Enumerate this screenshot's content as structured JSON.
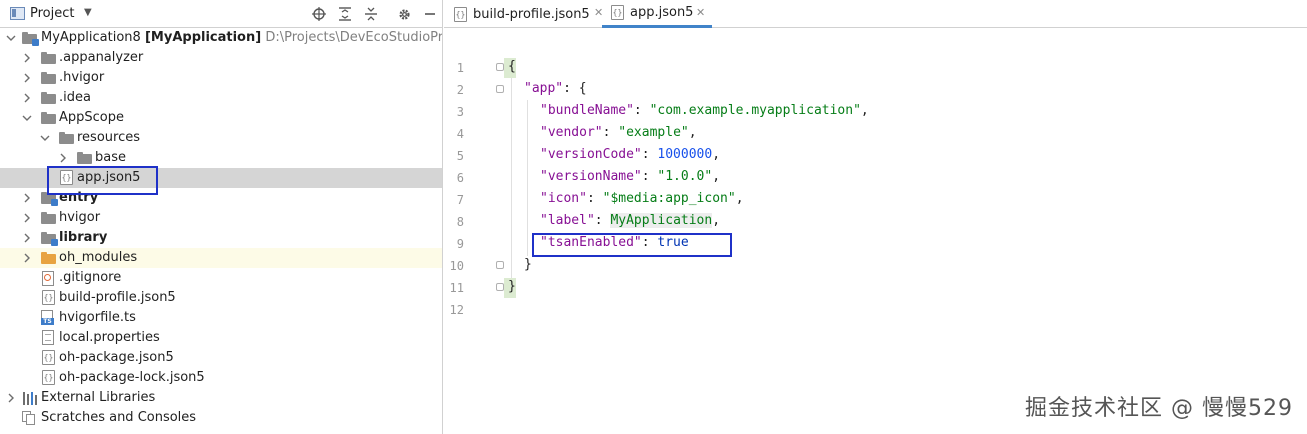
{
  "project_panel": {
    "title": "Project",
    "tree": [
      {
        "label": "MyApplication8",
        "bold_part": "[MyApplication]",
        "path": "D:\\Projects\\DevEcoStudioProjects\\"
      },
      {
        "label": ".appanalyzer"
      },
      {
        "label": ".hvigor"
      },
      {
        "label": ".idea"
      },
      {
        "label": "AppScope"
      },
      {
        "label": "resources"
      },
      {
        "label": "base"
      },
      {
        "label": "app.json5"
      },
      {
        "label": "entry"
      },
      {
        "label": "hvigor"
      },
      {
        "label": "library"
      },
      {
        "label": "oh_modules"
      },
      {
        "label": ".gitignore"
      },
      {
        "label": "build-profile.json5"
      },
      {
        "label": "hvigorfile.ts"
      },
      {
        "label": "local.properties"
      },
      {
        "label": "oh-package.json5"
      },
      {
        "label": "oh-package-lock.json5"
      },
      {
        "label": "External Libraries"
      },
      {
        "label": "Scratches and Consoles"
      }
    ]
  },
  "editor": {
    "tabs": [
      {
        "label": "build-profile.json5",
        "active": false
      },
      {
        "label": "app.json5",
        "active": true
      }
    ],
    "line_numbers": [
      "1",
      "2",
      "3",
      "4",
      "5",
      "6",
      "7",
      "8",
      "9",
      "10",
      "11",
      "12"
    ],
    "code": {
      "l1": "{",
      "l2_key": "\"app\"",
      "l2_rest": ": {",
      "l3_key": "\"bundleName\"",
      "l3_val": "\"com.example.myapplication\"",
      "l4_key": "\"vendor\"",
      "l4_val": "\"example\"",
      "l5_key": "\"versionCode\"",
      "l5_val": "1000000",
      "l6_key": "\"versionName\"",
      "l6_val": "\"1.0.0\"",
      "l7_key": "\"icon\"",
      "l7_val": "\"$media:app_icon\"",
      "l8_key": "\"label\"",
      "l8_val": "MyApplication",
      "l9_key": "\"tsanEnabled\"",
      "l9_val": "true",
      "l10": "}",
      "l11": "}",
      "sep_colon": ": ",
      "sep_comma": ","
    }
  },
  "watermark": "掘金技术社区 @ 慢慢529",
  "colors": {
    "highlight_box": "#1f31c8",
    "selection_row": "#d5d5d5",
    "string": "#067d17",
    "key": "#871094",
    "number": "#1750eb",
    "keyword": "#0033b3"
  }
}
